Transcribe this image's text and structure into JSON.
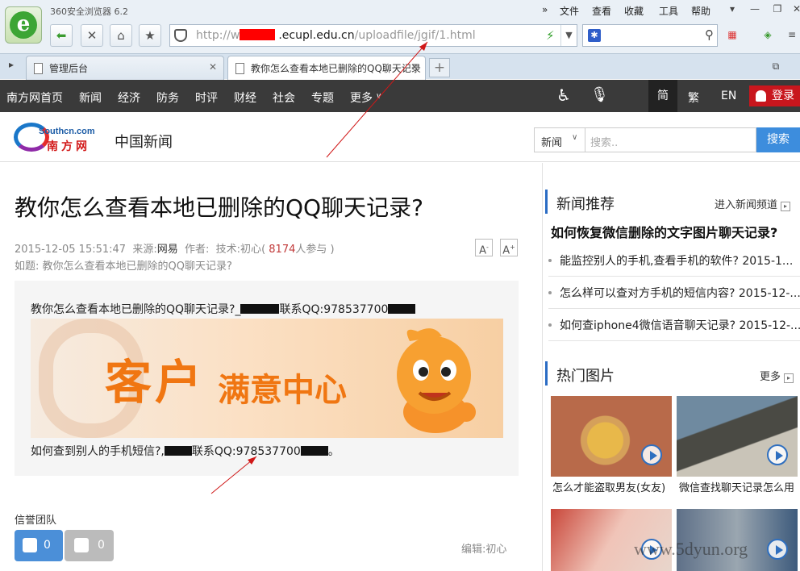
{
  "browser": {
    "title": "360安全浏览器 6.2",
    "menus": [
      "文件",
      "查看",
      "收藏",
      "工具",
      "帮助"
    ],
    "address_prefix": "http://w",
    "address_domain": ".ecupl.edu.cn",
    "address_path": "/uploadfile/jgif/1.html",
    "tabs": [
      {
        "label": "管理后台"
      },
      {
        "label": "教你怎么查看本地已删除的QQ聊天记录"
      }
    ]
  },
  "nav": {
    "items": [
      "南方网首页",
      "新闻",
      "经济",
      "防务",
      "时评",
      "财经",
      "社会",
      "专题",
      "更多"
    ],
    "lang": [
      "简",
      "繁",
      "EN"
    ],
    "login": "登录"
  },
  "header": {
    "brand_url": "Southcn.com",
    "brand_name": "南方网",
    "channel": "中国新闻",
    "search_select": "新闻",
    "search_placeholder": "搜索..",
    "search_button": "搜索"
  },
  "article": {
    "title": "教你怎么查看本地已删除的QQ聊天记录?",
    "date": "2015-12-05 15:51:47",
    "source_label": "来源:",
    "source": "网易",
    "author_label": "作者:",
    "tech_label": "技术:初心",
    "count": "8174",
    "count_suffix": "人参与",
    "font_small": "A",
    "font_large": "A",
    "related": "如题: 教你怎么查看本地已删除的QQ聊天记录?",
    "para1_a": "教你怎么查看本地已删除的QQ聊天记录?_",
    "para1_b": "联系QQ:978537700",
    "banner_big": "客户",
    "banner_small": "满意中心",
    "para2_a": "如何查到别人的手机短信?,",
    "para2_b": "联系QQ:978537700",
    "para2_c": "。",
    "team": "信誉团队",
    "likes": "0",
    "dislikes": "0",
    "editor": "编辑:初心"
  },
  "sidebar": {
    "news_title": "新闻推荐",
    "news_more": "进入新闻频道",
    "headline": "如何恢复微信删除的文字图片聊天记录?",
    "news": [
      "能监控别人的手机,查看手机的软件? 2015-1...",
      "怎么样可以查对方手机的短信内容? 2015-12-...",
      "如何查iphone4微信语音聊天记录? 2015-12-..."
    ],
    "pics_title": "热门图片",
    "pics_more": "更多",
    "pics": [
      "怎么才能盗取男友(女友)",
      "微信查找聊天记录怎么用",
      "",
      ""
    ]
  },
  "watermark": "www.5dyun.org",
  "colors": {
    "nav_bg": "#3a3a3a",
    "accent": "#2b6cc4",
    "login": "#c8161d",
    "redaction": "#ff0000"
  }
}
